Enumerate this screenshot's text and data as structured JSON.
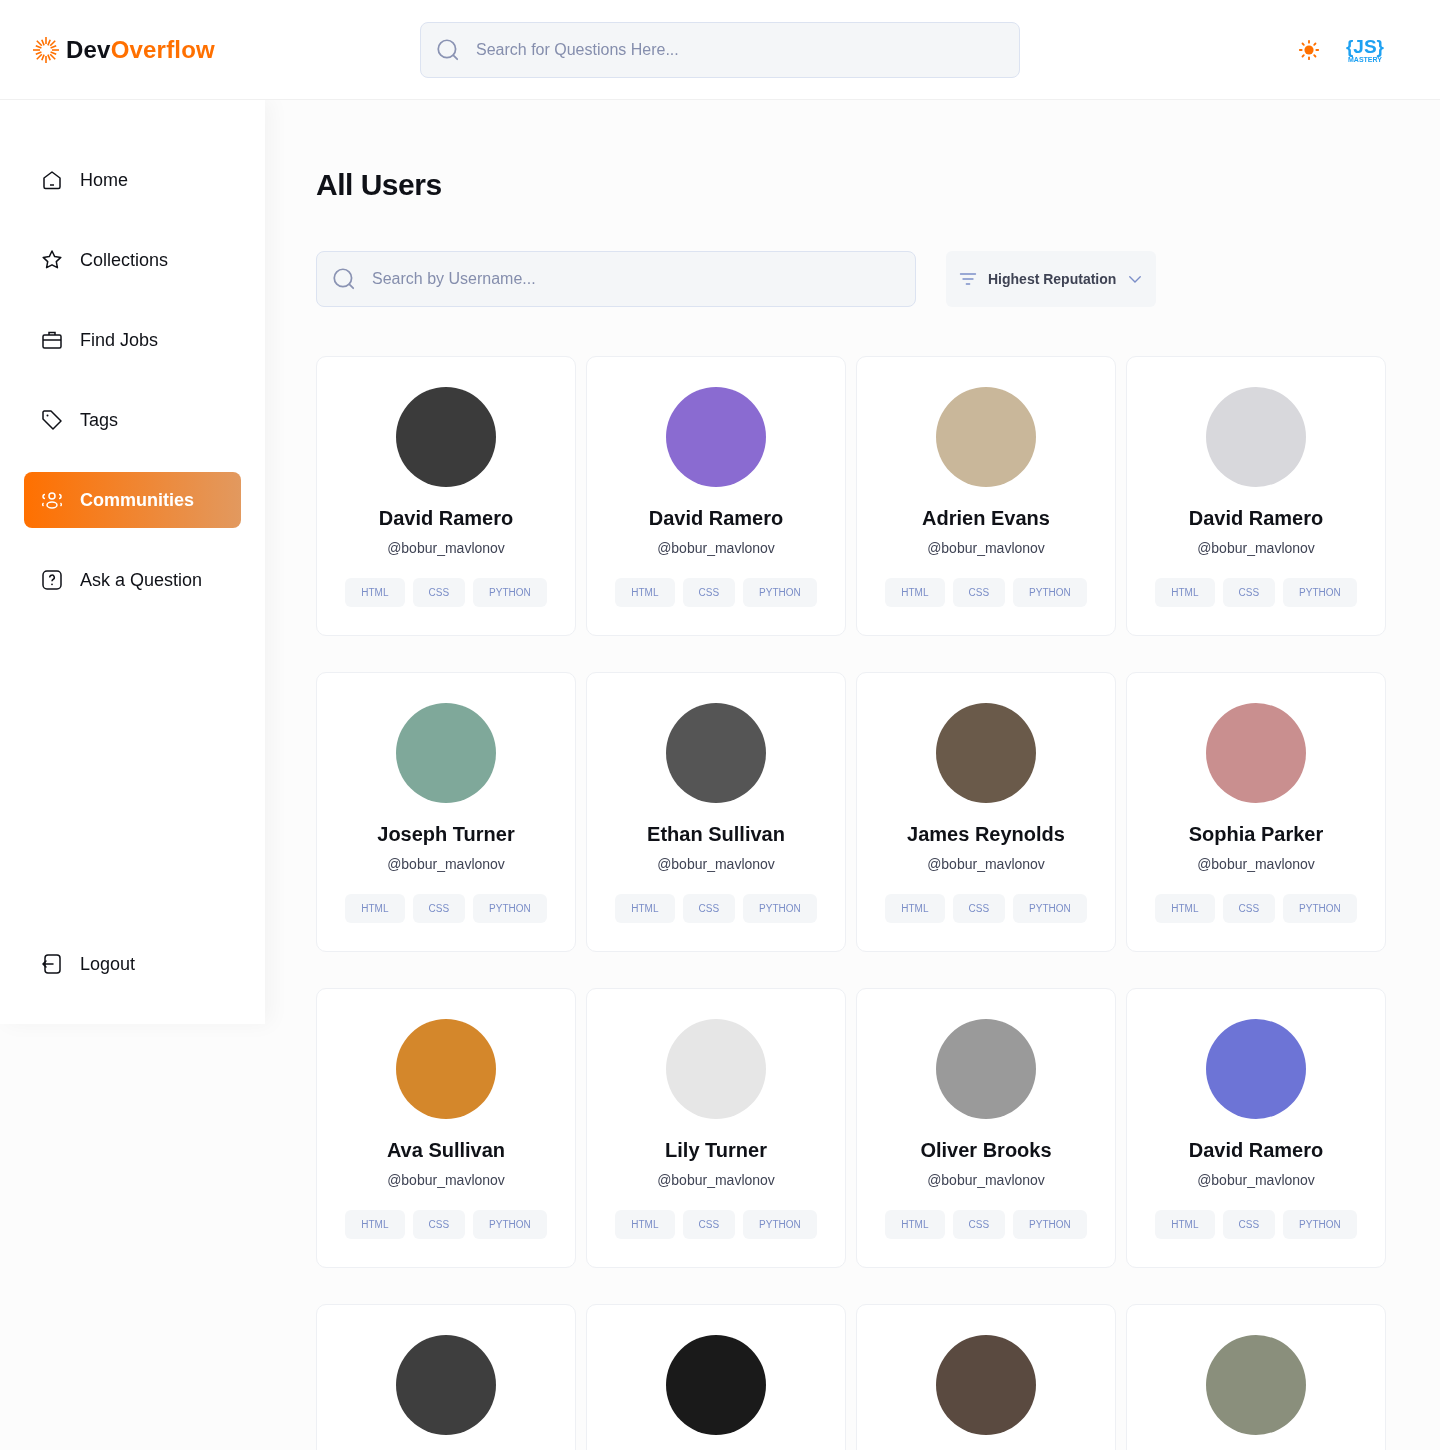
{
  "header": {
    "logo": {
      "part_1": "Dev",
      "part_2": "Overflow"
    },
    "search": {
      "placeholder": "Search for Questions Here..."
    },
    "brand_badge": {
      "mark": "{JS}",
      "caption": "MASTERY"
    }
  },
  "sidebar": {
    "items": [
      {
        "label": "Home",
        "kind": "home",
        "selected": false
      },
      {
        "label": "Collections",
        "kind": "star",
        "selected": false
      },
      {
        "label": "Find Jobs",
        "kind": "briefcase",
        "selected": false
      },
      {
        "label": "Tags",
        "kind": "tag",
        "selected": false
      },
      {
        "label": "Communities",
        "kind": "users",
        "selected": true
      },
      {
        "label": "Ask a Question",
        "kind": "question",
        "selected": false
      }
    ],
    "logout": {
      "label": "Logout"
    }
  },
  "page": {
    "title": "All Users",
    "search": {
      "placeholder": "Search by Username..."
    },
    "filter": {
      "value": "Highest Reputation"
    }
  },
  "users": [
    {
      "kind": "full",
      "name": "David Ramero",
      "handle": "@bobur_mavlonov",
      "tags": [
        "HTML",
        "CSS",
        "PYTHON"
      ]
    },
    {
      "kind": "full",
      "name": "David Ramero",
      "handle": "@bobur_mavlonov",
      "tags": [
        "HTML",
        "CSS",
        "PYTHON"
      ]
    },
    {
      "kind": "full",
      "name": "Adrien Evans",
      "handle": "@bobur_mavlonov",
      "tags": [
        "HTML",
        "CSS",
        "PYTHON"
      ]
    },
    {
      "kind": "full",
      "name": "David Ramero",
      "handle": "@bobur_mavlonov",
      "tags": [
        "HTML",
        "CSS",
        "PYTHON"
      ]
    },
    {
      "kind": "full",
      "name": "Joseph Turner",
      "handle": "@bobur_mavlonov",
      "tags": [
        "HTML",
        "CSS",
        "PYTHON"
      ]
    },
    {
      "kind": "full",
      "name": "Ethan Sullivan",
      "handle": "@bobur_mavlonov",
      "tags": [
        "HTML",
        "CSS",
        "PYTHON"
      ]
    },
    {
      "kind": "full",
      "name": "James Reynolds",
      "handle": "@bobur_mavlonov",
      "tags": [
        "HTML",
        "CSS",
        "PYTHON"
      ]
    },
    {
      "kind": "full",
      "name": "Sophia Parker",
      "handle": "@bobur_mavlonov",
      "tags": [
        "HTML",
        "CSS",
        "PYTHON"
      ]
    },
    {
      "kind": "full",
      "name": "Ava Sullivan",
      "handle": "@bobur_mavlonov",
      "tags": [
        "HTML",
        "CSS",
        "PYTHON"
      ]
    },
    {
      "kind": "full",
      "name": "Lily Turner",
      "handle": "@bobur_mavlonov",
      "tags": [
        "HTML",
        "CSS",
        "PYTHON"
      ]
    },
    {
      "kind": "full",
      "name": "Oliver Brooks",
      "handle": "@bobur_mavlonov",
      "tags": [
        "HTML",
        "CSS",
        "PYTHON"
      ]
    },
    {
      "kind": "full",
      "name": "David Ramero",
      "handle": "@bobur_mavlonov",
      "tags": [
        "HTML",
        "CSS",
        "PYTHON"
      ]
    },
    {
      "kind": "avatar_only"
    },
    {
      "kind": "avatar_only"
    },
    {
      "kind": "avatar_only"
    },
    {
      "kind": "avatar_only"
    }
  ]
}
